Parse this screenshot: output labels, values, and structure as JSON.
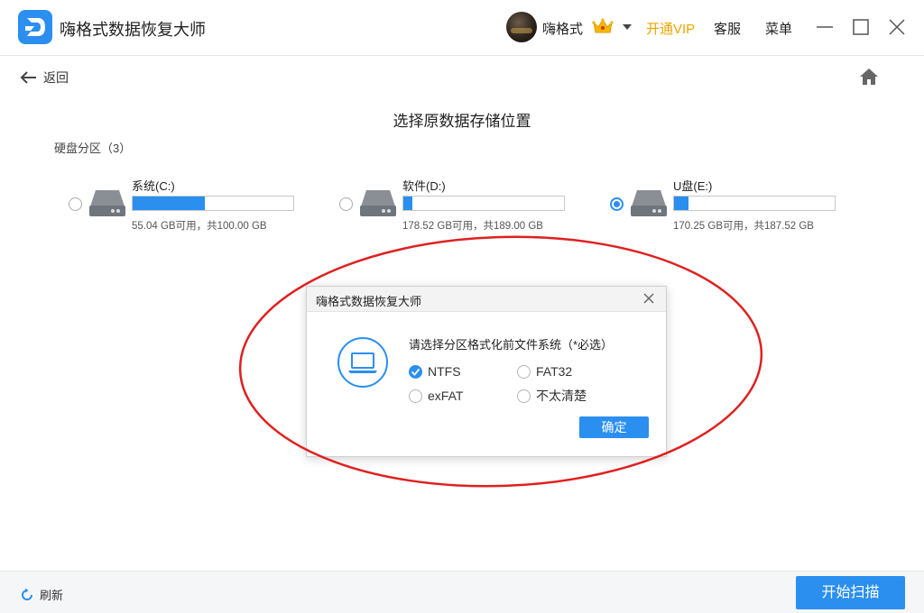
{
  "app": {
    "title": "嗨格式数据恢复大师"
  },
  "header": {
    "username": "嗨格式",
    "vip_label": "开通VIP",
    "service_label": "客服",
    "menu_label": "菜单"
  },
  "nav": {
    "back_label": "返回"
  },
  "page": {
    "title": "选择原数据存储位置",
    "section_label": "硬盘分区（3）"
  },
  "drives": [
    {
      "name": "系统(C:)",
      "usage": "55.04 GB可用，共100.00 GB",
      "used_fraction": 0.45,
      "selected": false
    },
    {
      "name": "软件(D:)",
      "usage": "178.52 GB可用，共189.00 GB",
      "used_fraction": 0.055,
      "selected": false
    },
    {
      "name": "U盘(E:)",
      "usage": "170.25 GB可用，共187.52 GB",
      "used_fraction": 0.092,
      "selected": true
    }
  ],
  "dialog": {
    "title": "嗨格式数据恢复大师",
    "prompt": "请选择分区格式化前文件系统（*必选）",
    "options": [
      {
        "label": "NTFS",
        "checked": true
      },
      {
        "label": "FAT32",
        "checked": false
      },
      {
        "label": "exFAT",
        "checked": false
      },
      {
        "label": "不太清楚",
        "checked": false
      }
    ],
    "confirm_label": "确定"
  },
  "footer": {
    "refresh_label": "刷新",
    "scan_label": "开始扫描"
  },
  "colors": {
    "accent": "#2b8ff0",
    "vip": "#f0a500",
    "annotation": "#e02020"
  },
  "icons": [
    "logo-icon",
    "crown-icon",
    "chevron-down-icon",
    "minimize-icon",
    "maximize-icon",
    "close-icon",
    "back-arrow-icon",
    "home-icon",
    "hard-drive-icon",
    "laptop-icon",
    "checkmark-icon",
    "refresh-icon"
  ]
}
